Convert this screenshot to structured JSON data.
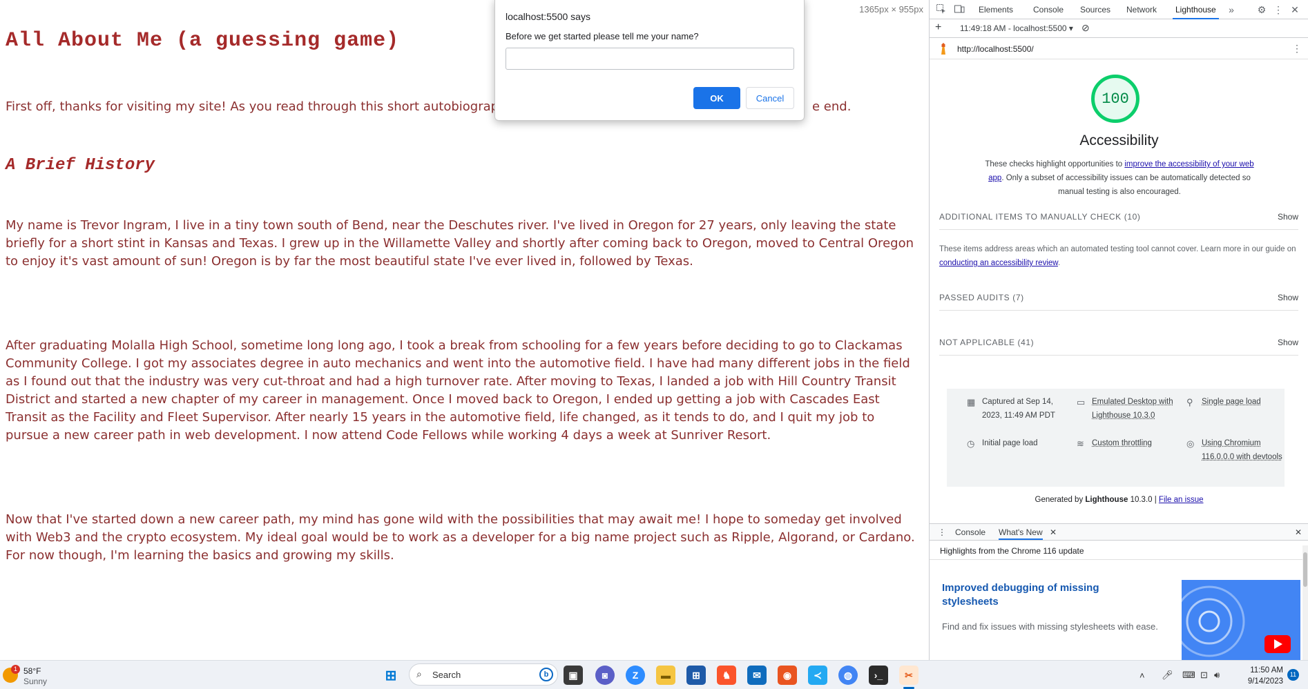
{
  "page": {
    "dimensions_label": "1365px × 955px",
    "title": "All About Me (a guessing game)",
    "intro": "First off, thanks for visiting my site! As you read through this short autobiography, p",
    "intro_tail": "e end.",
    "section_heading": "A Brief History",
    "paragraphs": [
      "My name is Trevor Ingram, I live in a tiny town south of Bend, near the Deschutes river. I've lived in Oregon for 27 years, only leaving the state briefly for a short stint in Kansas and Texas. I grew up in the Willamette Valley and shortly after coming back to Oregon, moved to Central Oregon to enjoy it's vast amount of sun! Oregon is by far the most beautiful state I've ever lived in, followed by Texas.",
      "After graduating Molalla High School, sometime long long ago, I took a break from schooling for a few years before deciding to go to Clackamas Community College. I got my associates degree in auto mechanics and went into the automotive field. I have had many different jobs in the field as I found out that the industry was very cut-throat and had a high turnover rate. After moving to Texas, I landed a job with Hill Country Transit District and started a new chapter of my career in management. Once I moved back to Oregon, I ended up getting a job with Cascades East Transit as the Facility and Fleet Supervisor. After nearly 15 years in the automotive field, life changed, as it tends to do, and I quit my job to pursue a new career path in web development. I now attend Code Fellows while working 4 days a week at Sunriver Resort.",
      "Now that I've started down a new career path, my mind has gone wild with the possibilities that may await me! I hope to someday get involved with Web3 and the crypto ecosystem. My ideal goal would be to work as a developer for a big name project such as Ripple, Algorand, or Cardano. For now though, I'm learning the basics and growing my skills."
    ],
    "text_color": "#8b3030"
  },
  "dialog": {
    "origin": "localhost:5500 says",
    "message": "Before we get started please tell me your name?",
    "input_value": "",
    "ok_label": "OK",
    "cancel_label": "Cancel",
    "accent": "#1a73e8"
  },
  "devtools": {
    "tabs": [
      "Elements",
      "Console",
      "Sources",
      "Network",
      "Lighthouse"
    ],
    "active_tab": "Lighthouse",
    "report_selector": "11:49:18 AM - localhost:5500",
    "url": "http://localhost:5500/",
    "score": "100",
    "score_color": "#0cce6b",
    "category": "Accessibility",
    "desc_prefix": "These checks highlight opportunities to ",
    "desc_link": "improve the accessibility of your web app",
    "desc_suffix": ". Only a subset of accessibility issues can be automatically detected so manual testing is also encouraged.",
    "sections": [
      {
        "label": "ADDITIONAL ITEMS TO MANUALLY CHECK",
        "count": "(10)",
        "action": "Show"
      },
      {
        "label": "PASSED AUDITS",
        "count": "(7)",
        "action": "Show"
      },
      {
        "label": "NOT APPLICABLE",
        "count": "(41)",
        "action": "Show"
      }
    ],
    "manual_note_prefix": "These items address areas which an automated testing tool cannot cover. Learn more in our guide on ",
    "manual_note_link": "conducting an accessibility review",
    "manual_note_suffix": ".",
    "env": [
      {
        "icon": "calendar-icon",
        "text": "Captured at Sep 14, 2023, 11:49 AM PDT",
        "linked": false
      },
      {
        "icon": "desktop-icon",
        "text": "Emulated Desktop with Lighthouse 10.3.0",
        "linked": true
      },
      {
        "icon": "single-page-icon",
        "text": "Single page load",
        "linked": true
      },
      {
        "icon": "timer-icon",
        "text": "Initial page load",
        "linked": false
      },
      {
        "icon": "wifi-icon",
        "text": "Custom throttling",
        "linked": true
      },
      {
        "icon": "chromium-icon",
        "text": "Using Chromium 116.0.0.0 with devtools",
        "linked": true
      }
    ],
    "generated_prefix": "Generated by ",
    "generated_brand": "Lighthouse",
    "generated_version": " 10.3.0 | ",
    "generated_link": "File an issue",
    "drawer_tabs": [
      "Console",
      "What's New"
    ],
    "drawer_highlights": "Highlights from the Chrome 116 update",
    "whatsnew_title": "Improved debugging of missing stylesheets",
    "whatsnew_desc": "Find and fix issues with missing stylesheets with ease."
  },
  "taskbar": {
    "weather_temp": "58°F",
    "weather_desc": "Sunny",
    "weather_badge": "1",
    "search_placeholder": "Search",
    "time": "11:50 AM",
    "date": "9/14/2023",
    "notification_count": "11"
  }
}
